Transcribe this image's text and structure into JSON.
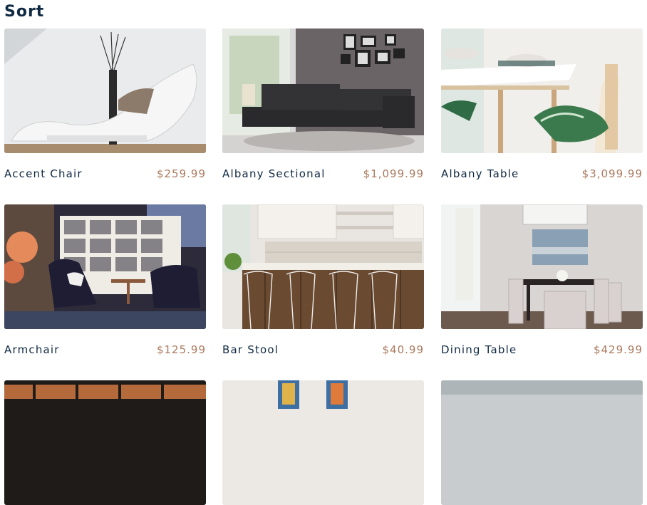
{
  "page": {
    "title": "Sort"
  },
  "products": [
    {
      "name": "Accent Chair",
      "price": "$259.99",
      "image": "accent-chair-photo"
    },
    {
      "name": "Albany Sectional",
      "price": "$1,099.99",
      "image": "albany-sectional-photo"
    },
    {
      "name": "Albany Table",
      "price": "$3,099.99",
      "image": "albany-table-photo"
    },
    {
      "name": "Armchair",
      "price": "$125.99",
      "image": "armchair-photo"
    },
    {
      "name": "Bar Stool",
      "price": "$40.99",
      "image": "bar-stool-photo"
    },
    {
      "name": "Dining Table",
      "price": "$429.99",
      "image": "dining-table-photo"
    },
    {
      "image": "product-photo-7"
    },
    {
      "image": "product-photo-8"
    },
    {
      "image": "product-photo-9"
    }
  ]
}
